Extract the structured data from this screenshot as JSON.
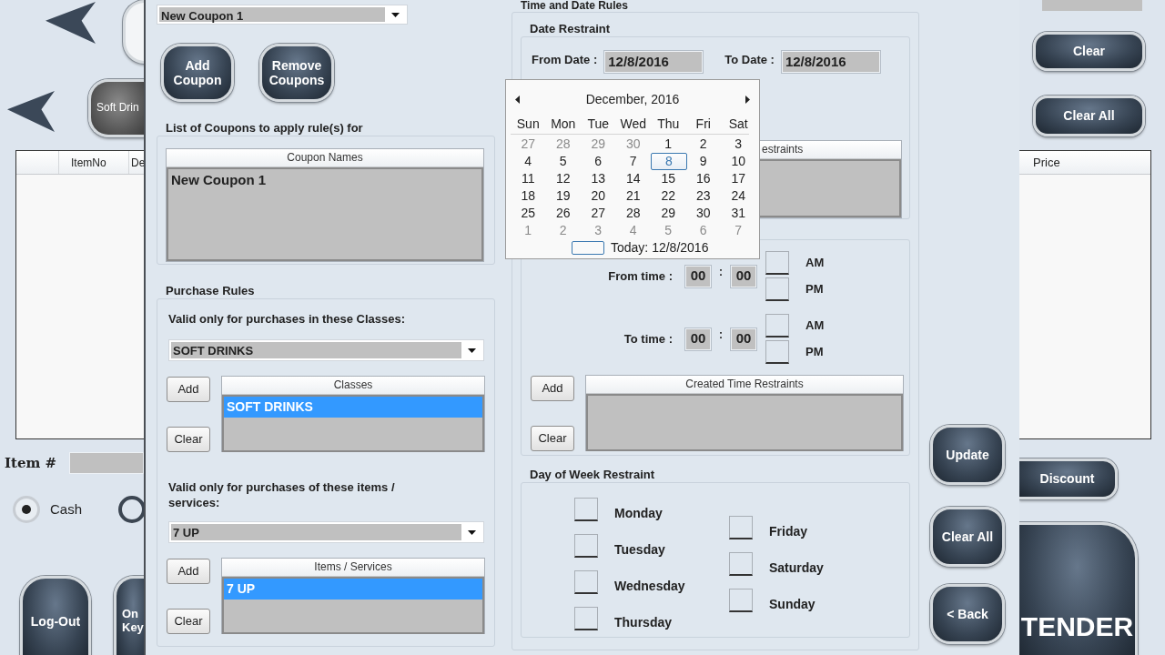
{
  "background_app": {
    "left_panel": {
      "soft_drink_button": "Soft Drin",
      "order_table": {
        "columns": [
          "ItemNo",
          "De"
        ]
      },
      "item_label": "Item #",
      "payment_options": [
        {
          "label": "Cash",
          "selected": true
        },
        {
          "selected": false
        }
      ],
      "logout_button": "Log-Out",
      "key_button": [
        "On",
        "Key"
      ]
    },
    "right_panel": {
      "clear_button": "Clear",
      "clear_all_button": "Clear All",
      "order_table": {
        "columns": [
          "Price"
        ]
      },
      "discount_button": "Discount",
      "tender_button": "TENDER"
    }
  },
  "coupon_dialog": {
    "coupon_select": "New Coupon 1",
    "add_coupon_button": "Add Coupon",
    "remove_coupons_button": "Remove Coupons",
    "coupon_list": {
      "title": "List of Coupons to apply rule(s) for",
      "column": "Coupon Names",
      "items": [
        {
          "label": "New Coupon 1",
          "selected": false
        }
      ]
    },
    "purchase_rules": {
      "title": "Purchase Rules",
      "class_rule": {
        "prompt": "Valid only for purchases in these Classes:",
        "select": "SOFT DRINKS",
        "add_button": "Add",
        "clear_button": "Clear",
        "column": "Classes",
        "items": [
          {
            "label": "SOFT DRINKS",
            "selected": true
          }
        ]
      },
      "item_rule": {
        "prompt": "Valid only for purchases of these items / services:",
        "select": "7 UP",
        "add_button": "Add",
        "clear_button": "Clear",
        "column": "Items / Services",
        "items": [
          {
            "label": "7 UP",
            "selected": true
          }
        ]
      }
    },
    "time_and_date_rules": {
      "title": "Time and Date Rules",
      "date_restraint": {
        "title": "Date Restraint",
        "from_label": "From Date :",
        "from_value": "12/8/2016",
        "to_label": "To Date :",
        "to_value": "12/8/2016",
        "column": "estraints"
      },
      "time_restraint": {
        "rows": [
          {
            "label": "From time :",
            "hour": "00",
            "minute": "00",
            "separator": ":",
            "am": {
              "label": "AM",
              "checked": false
            },
            "pm": {
              "label": "PM",
              "checked": false
            }
          },
          {
            "label": "To time :",
            "hour": "00",
            "minute": "00",
            "separator": ":",
            "am": {
              "label": "AM",
              "checked": false
            },
            "pm": {
              "label": "PM",
              "checked": false
            }
          }
        ],
        "add_button": "Add",
        "clear_button": "Clear",
        "column": "Created Time Restraints"
      },
      "day_of_week_restraint": {
        "title": "Day of Week Restraint",
        "columns": [
          [
            {
              "label": "Monday",
              "checked": false
            },
            {
              "label": "Tuesday",
              "checked": false
            },
            {
              "label": "Wednesday",
              "checked": false
            },
            {
              "label": "Thursday",
              "checked": false
            }
          ],
          [
            {
              "label": "Friday",
              "checked": false
            },
            {
              "label": "Saturday",
              "checked": false
            },
            {
              "label": "Sunday",
              "checked": false
            }
          ]
        ]
      }
    },
    "calendar": {
      "month": "December, 2016",
      "weekdays": [
        "Sun",
        "Mon",
        "Tue",
        "Wed",
        "Thu",
        "Fri",
        "Sat"
      ],
      "weeks": [
        [
          {
            "day": "27",
            "other_month": true,
            "selected": false
          },
          {
            "day": "28",
            "other_month": true,
            "selected": false
          },
          {
            "day": "29",
            "other_month": true,
            "selected": false
          },
          {
            "day": "30",
            "other_month": true,
            "selected": false
          },
          {
            "day": "1",
            "other_month": false,
            "selected": false
          },
          {
            "day": "2",
            "other_month": false,
            "selected": false
          },
          {
            "day": "3",
            "other_month": false,
            "selected": false
          }
        ],
        [
          {
            "day": "4",
            "other_month": false,
            "selected": false
          },
          {
            "day": "5",
            "other_month": false,
            "selected": false
          },
          {
            "day": "6",
            "other_month": false,
            "selected": false
          },
          {
            "day": "7",
            "other_month": false,
            "selected": false
          },
          {
            "day": "8",
            "other_month": false,
            "selected": true
          },
          {
            "day": "9",
            "other_month": false,
            "selected": false
          },
          {
            "day": "10",
            "other_month": false,
            "selected": false
          }
        ],
        [
          {
            "day": "11",
            "other_month": false,
            "selected": false
          },
          {
            "day": "12",
            "other_month": false,
            "selected": false
          },
          {
            "day": "13",
            "other_month": false,
            "selected": false
          },
          {
            "day": "14",
            "other_month": false,
            "selected": false
          },
          {
            "day": "15",
            "other_month": false,
            "selected": false
          },
          {
            "day": "16",
            "other_month": false,
            "selected": false
          },
          {
            "day": "17",
            "other_month": false,
            "selected": false
          }
        ],
        [
          {
            "day": "18",
            "other_month": false,
            "selected": false
          },
          {
            "day": "19",
            "other_month": false,
            "selected": false
          },
          {
            "day": "20",
            "other_month": false,
            "selected": false
          },
          {
            "day": "21",
            "other_month": false,
            "selected": false
          },
          {
            "day": "22",
            "other_month": false,
            "selected": false
          },
          {
            "day": "23",
            "other_month": false,
            "selected": false
          },
          {
            "day": "24",
            "other_month": false,
            "selected": false
          }
        ],
        [
          {
            "day": "25",
            "other_month": false,
            "selected": false
          },
          {
            "day": "26",
            "other_month": false,
            "selected": false
          },
          {
            "day": "27",
            "other_month": false,
            "selected": false
          },
          {
            "day": "28",
            "other_month": false,
            "selected": false
          },
          {
            "day": "29",
            "other_month": false,
            "selected": false
          },
          {
            "day": "30",
            "other_month": false,
            "selected": false
          },
          {
            "day": "31",
            "other_month": false,
            "selected": false
          }
        ],
        [
          {
            "day": "1",
            "other_month": true,
            "selected": false
          },
          {
            "day": "2",
            "other_month": true,
            "selected": false
          },
          {
            "day": "3",
            "other_month": true,
            "selected": false
          },
          {
            "day": "4",
            "other_month": true,
            "selected": false
          },
          {
            "day": "5",
            "other_month": true,
            "selected": false
          },
          {
            "day": "6",
            "other_month": true,
            "selected": false
          },
          {
            "day": "7",
            "other_month": true,
            "selected": false
          }
        ]
      ],
      "today": "Today: 12/8/2016"
    },
    "update_button": "Update",
    "clear_all_button": "Clear All",
    "back_button": "< Back"
  }
}
